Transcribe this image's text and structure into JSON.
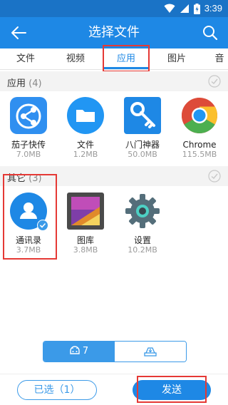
{
  "status_bar": {
    "time": "3:39"
  },
  "app_bar": {
    "title": "选择文件"
  },
  "tabs": [
    {
      "label": "文件"
    },
    {
      "label": "视频"
    },
    {
      "label": "应用"
    },
    {
      "label": "图片"
    },
    {
      "label": "音"
    }
  ],
  "section_apps": {
    "title": "应用",
    "count": "(4)",
    "items": [
      {
        "name": "茄子快传",
        "size": "7.0MB",
        "icon": "share-app-icon"
      },
      {
        "name": "文件",
        "size": "1.2MB",
        "icon": "folder-icon"
      },
      {
        "name": "八门神器",
        "size": "50.0MB",
        "icon": "key-icon"
      },
      {
        "name": "Chrome",
        "size": "115.5MB",
        "icon": "chrome-icon"
      }
    ]
  },
  "section_other": {
    "title": "其它",
    "count": "(3)",
    "items": [
      {
        "name": "通讯录",
        "size": "3.7MB",
        "icon": "contacts-icon",
        "selected": true
      },
      {
        "name": "图库",
        "size": "3.8MB",
        "icon": "gallery-icon"
      },
      {
        "name": "设置",
        "size": "10.2MB",
        "icon": "settings-gear-icon"
      }
    ]
  },
  "toggle": {
    "left_count": "7"
  },
  "actions": {
    "selected_label": "已选（1）",
    "send_label": "发送"
  },
  "colors": {
    "primary": "#1e88e5",
    "status_bar": "#1a73c6",
    "highlight": "#e53935"
  }
}
